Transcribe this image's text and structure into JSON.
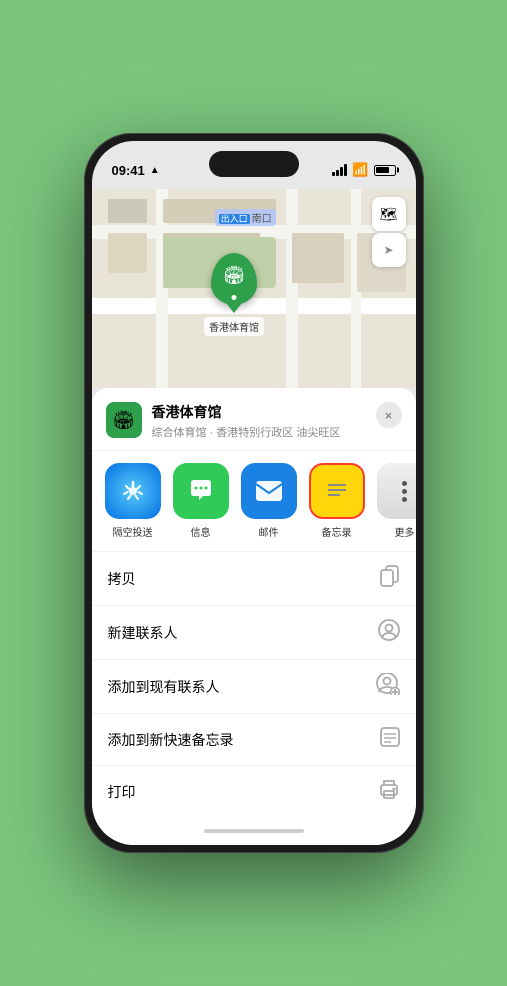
{
  "phone": {
    "status_bar": {
      "time": "09:41",
      "location_arrow": "▲"
    }
  },
  "map": {
    "label": "南口",
    "controls": {
      "map_btn": "🗺",
      "location_btn": "➤"
    },
    "marker": {
      "label": "香港体育馆"
    }
  },
  "venue_card": {
    "title": "香港体育馆",
    "subtitle": "综合体育馆 · 香港特别行政区 油尖旺区",
    "close_label": "×"
  },
  "share_row": {
    "items": [
      {
        "label": "隔空投送",
        "type": "airdrop"
      },
      {
        "label": "信息",
        "type": "messages"
      },
      {
        "label": "邮件",
        "type": "mail"
      },
      {
        "label": "备忘录",
        "type": "notes"
      },
      {
        "label": "更多",
        "type": "more"
      }
    ]
  },
  "actions": [
    {
      "label": "拷贝",
      "icon": "📋"
    },
    {
      "label": "新建联系人",
      "icon": "👤"
    },
    {
      "label": "添加到现有联系人",
      "icon": "👤"
    },
    {
      "label": "添加到新快速备忘录",
      "icon": "📝"
    },
    {
      "label": "打印",
      "icon": "🖨"
    }
  ]
}
